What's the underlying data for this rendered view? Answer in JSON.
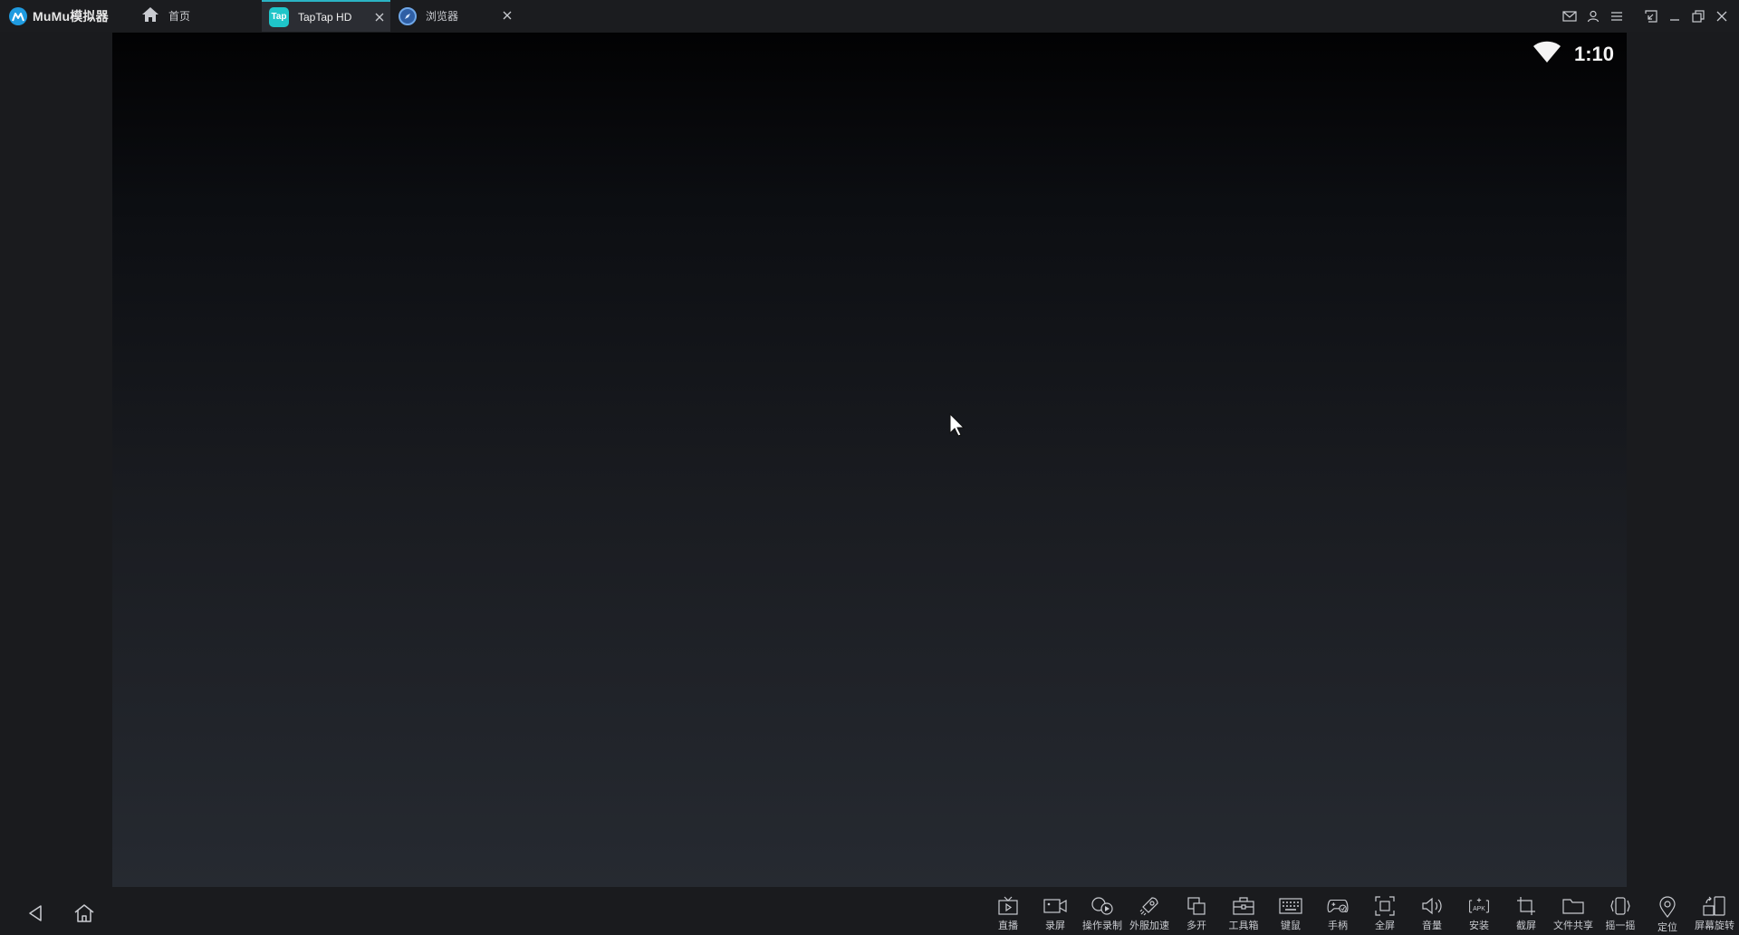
{
  "app": {
    "title": "MuMu模拟器"
  },
  "tabs": [
    {
      "label": "首页"
    },
    {
      "label": "TapTap HD",
      "icon_text": "Tap"
    },
    {
      "label": "浏览器"
    }
  ],
  "status": {
    "time": "1:10"
  },
  "toolbar": [
    {
      "label": "直播",
      "icon": "live-tv-icon"
    },
    {
      "label": "录屏",
      "icon": "camera-record-icon"
    },
    {
      "label": "操作录制",
      "icon": "operation-record-icon"
    },
    {
      "label": "外服加速",
      "icon": "rocket-icon"
    },
    {
      "label": "多开",
      "icon": "multi-instance-icon"
    },
    {
      "label": "工具箱",
      "icon": "toolbox-icon"
    },
    {
      "label": "键鼠",
      "icon": "keyboard-icon"
    },
    {
      "label": "手柄",
      "icon": "gamepad-icon"
    },
    {
      "label": "全屏",
      "icon": "fullscreen-icon"
    },
    {
      "label": "音量",
      "icon": "volume-icon"
    },
    {
      "label": "安装",
      "icon": "apk-install-icon",
      "icon_text": "APK"
    },
    {
      "label": "截屏",
      "icon": "crop-screenshot-icon"
    },
    {
      "label": "文件共享",
      "icon": "folder-share-icon"
    },
    {
      "label": "摇一摇",
      "icon": "shake-icon"
    },
    {
      "label": "定位",
      "icon": "location-icon"
    },
    {
      "label": "屏幕旋转",
      "icon": "rotate-screen-icon"
    }
  ],
  "colors": {
    "accent": "#2bb3c4",
    "logo": "#1f9be0",
    "taptap": "#1fc5c9"
  }
}
